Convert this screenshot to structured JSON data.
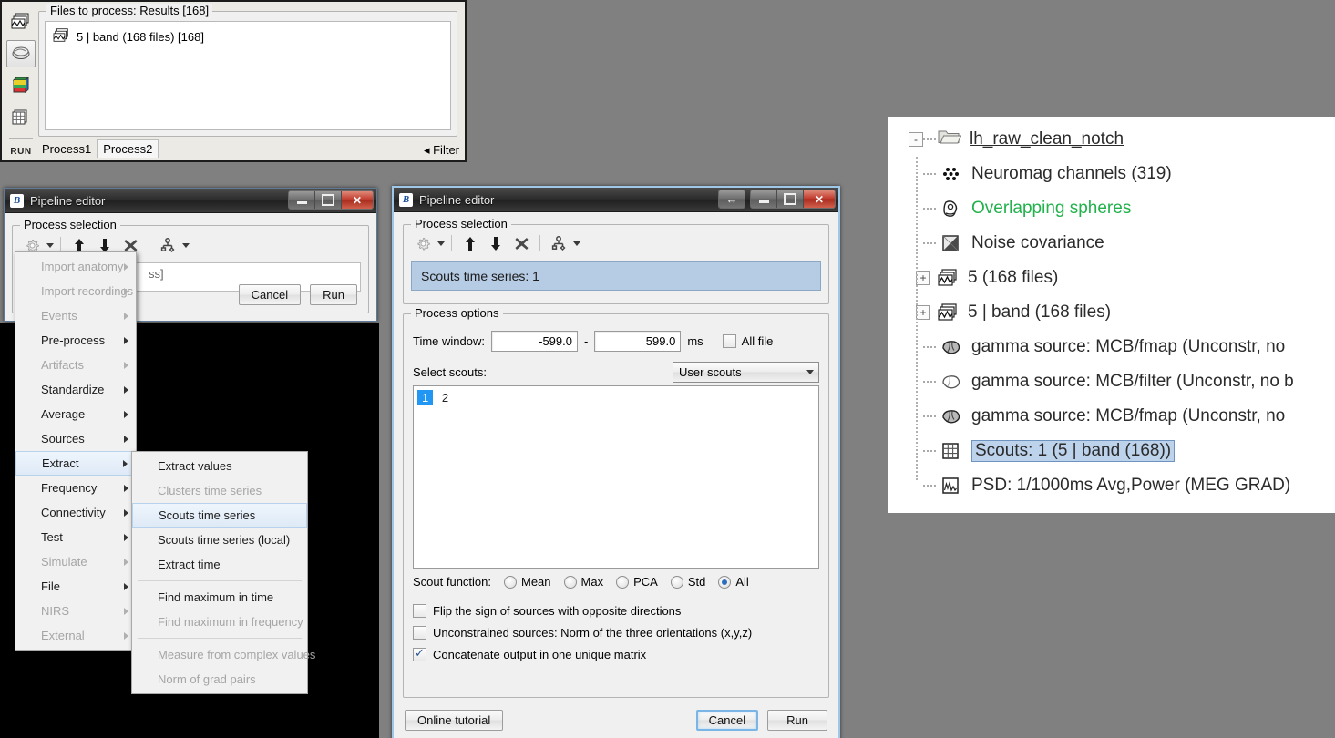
{
  "background_color": "#808080",
  "process_window": {
    "files_group_title": "Files to process: Results [168]",
    "file_item": "5  | band (168 files) [168]",
    "sidebar_icons": [
      "recordings-stack-icon",
      "sources-icon",
      "timefreq-icon",
      "matrix-icon"
    ],
    "run_label": "RUN",
    "tabs": [
      {
        "label": "Process1",
        "active": false
      },
      {
        "label": "Process2",
        "active": true
      }
    ],
    "filter_label": "Filter",
    "filter_arrow": "◂"
  },
  "left_dialog": {
    "title": "Pipeline editor",
    "group_title": "Process selection",
    "toolbar": [
      "gear-icon",
      "move-up-icon",
      "move-down-icon",
      "delete-icon",
      "pipeline-icon"
    ],
    "hidden_text": "ss]",
    "cancel_label": "Cancel",
    "run_label": "Run",
    "window_buttons": [
      "minimize",
      "maximize",
      "close"
    ]
  },
  "context_menu": {
    "items": [
      {
        "label": "Import anatomy",
        "disabled": true,
        "submenu": true
      },
      {
        "label": "Import recordings",
        "disabled": true,
        "submenu": true
      },
      {
        "label": "Events",
        "disabled": true,
        "submenu": true
      },
      {
        "label": "Pre-process",
        "disabled": false,
        "submenu": true
      },
      {
        "label": "Artifacts",
        "disabled": true,
        "submenu": true
      },
      {
        "label": "Standardize",
        "disabled": false,
        "submenu": true
      },
      {
        "label": "Average",
        "disabled": false,
        "submenu": true
      },
      {
        "label": "Sources",
        "disabled": false,
        "submenu": true
      },
      {
        "label": "Extract",
        "disabled": false,
        "submenu": true,
        "highlighted": true
      },
      {
        "label": "Frequency",
        "disabled": false,
        "submenu": true
      },
      {
        "label": "Connectivity",
        "disabled": false,
        "submenu": true
      },
      {
        "label": "Test",
        "disabled": false,
        "submenu": true
      },
      {
        "label": "Simulate",
        "disabled": true,
        "submenu": true
      },
      {
        "label": "File",
        "disabled": false,
        "submenu": true
      },
      {
        "label": "NIRS",
        "disabled": true,
        "submenu": true
      },
      {
        "label": "External",
        "disabled": true,
        "submenu": true
      }
    ]
  },
  "submenu": {
    "items": [
      {
        "label": "Extract values",
        "disabled": false,
        "highlighted": false,
        "sep_after": false
      },
      {
        "label": "Clusters time series",
        "disabled": true,
        "highlighted": false,
        "sep_after": false
      },
      {
        "label": "Scouts time series",
        "disabled": false,
        "highlighted": true,
        "sep_after": false
      },
      {
        "label": "Scouts time series (local)",
        "disabled": false,
        "highlighted": false,
        "sep_after": false
      },
      {
        "label": "Extract time",
        "disabled": false,
        "highlighted": false,
        "sep_after": true
      },
      {
        "label": "Find maximum in time",
        "disabled": false,
        "highlighted": false,
        "sep_after": false
      },
      {
        "label": "Find maximum in frequency",
        "disabled": true,
        "highlighted": false,
        "sep_after": true
      },
      {
        "label": "Measure from complex values",
        "disabled": true,
        "highlighted": false,
        "sep_after": false
      },
      {
        "label": "Norm of grad pairs",
        "disabled": true,
        "highlighted": false,
        "sep_after": false
      }
    ]
  },
  "main_dialog": {
    "title": "Pipeline editor",
    "window_buttons": [
      "resize",
      "minimize",
      "maximize",
      "close"
    ],
    "process_selection": {
      "group_title": "Process selection",
      "toolbar": [
        "gear-icon",
        "move-up-icon",
        "move-down-icon",
        "delete-icon",
        "pipeline-icon"
      ],
      "selected_process": "Scouts time series: 1"
    },
    "process_options": {
      "group_title": "Process options",
      "time_window_label": "Time window:",
      "time_start": "-599.0",
      "time_separator": "-",
      "time_stop": "599.0",
      "time_unit": "ms",
      "all_file_label": "All file",
      "all_file_checked": false,
      "select_scouts_label": "Select scouts:",
      "scouts_source": "User scouts",
      "scout_list": [
        {
          "label": "1",
          "selected": true
        },
        {
          "label": "2",
          "selected": false
        }
      ],
      "scout_function_label": "Scout function:",
      "scout_functions": [
        {
          "label": "Mean",
          "selected": false
        },
        {
          "label": "Max",
          "selected": false
        },
        {
          "label": "PCA",
          "selected": false
        },
        {
          "label": "Std",
          "selected": false
        },
        {
          "label": "All",
          "selected": true
        }
      ],
      "checkboxes": [
        {
          "label": "Flip the sign of sources with opposite directions",
          "checked": false
        },
        {
          "label": "Unconstrained sources: Norm of the three orientations (x,y,z)",
          "checked": false
        },
        {
          "label": "Concatenate output in one unique matrix",
          "checked": true
        }
      ]
    },
    "online_tutorial_label": "Online tutorial",
    "cancel_label": "Cancel",
    "run_label": "Run"
  },
  "tree_panel": {
    "root": {
      "label": "lh_raw_clean_notch",
      "icon": "folder-open-icon",
      "expander": "-"
    },
    "nodes": [
      {
        "label": "Neuromag channels (319)",
        "icon": "channels-icon",
        "color": "#2b2b2b",
        "expander": null,
        "selected": false
      },
      {
        "label": "Overlapping spheres",
        "icon": "head-model-icon",
        "color": "#22b14c",
        "expander": null,
        "selected": false
      },
      {
        "label": "Noise covariance",
        "icon": "noise-covariance-icon",
        "color": "#2b2b2b",
        "expander": null,
        "selected": false
      },
      {
        "label": "5 (168 files)",
        "icon": "recordings-stack-icon",
        "color": "#2b2b2b",
        "expander": "+",
        "selected": false
      },
      {
        "label": "5  | band (168 files)",
        "icon": "recordings-stack-icon",
        "color": "#2b2b2b",
        "expander": "+",
        "selected": false
      },
      {
        "label": "gamma source: MCB/fmap (Unconstr, no",
        "icon": "source-filled-icon",
        "color": "#2b2b2b",
        "expander": null,
        "selected": false
      },
      {
        "label": "gamma source: MCB/filter (Unconstr, no b",
        "icon": "source-empty-icon",
        "color": "#2b2b2b",
        "expander": null,
        "selected": false
      },
      {
        "label": "gamma source: MCB/fmap (Unconstr, no",
        "icon": "source-filled-icon",
        "color": "#2b2b2b",
        "expander": null,
        "selected": false
      },
      {
        "label": "Scouts: 1 (5  | band (168))",
        "icon": "matrix-icon",
        "color": "#2b2b2b",
        "expander": null,
        "selected": true
      },
      {
        "label": "PSD: 1/1000ms Avg,Power (MEG GRAD)",
        "icon": "psd-icon",
        "color": "#2b2b2b",
        "expander": null,
        "selected": false
      }
    ]
  }
}
